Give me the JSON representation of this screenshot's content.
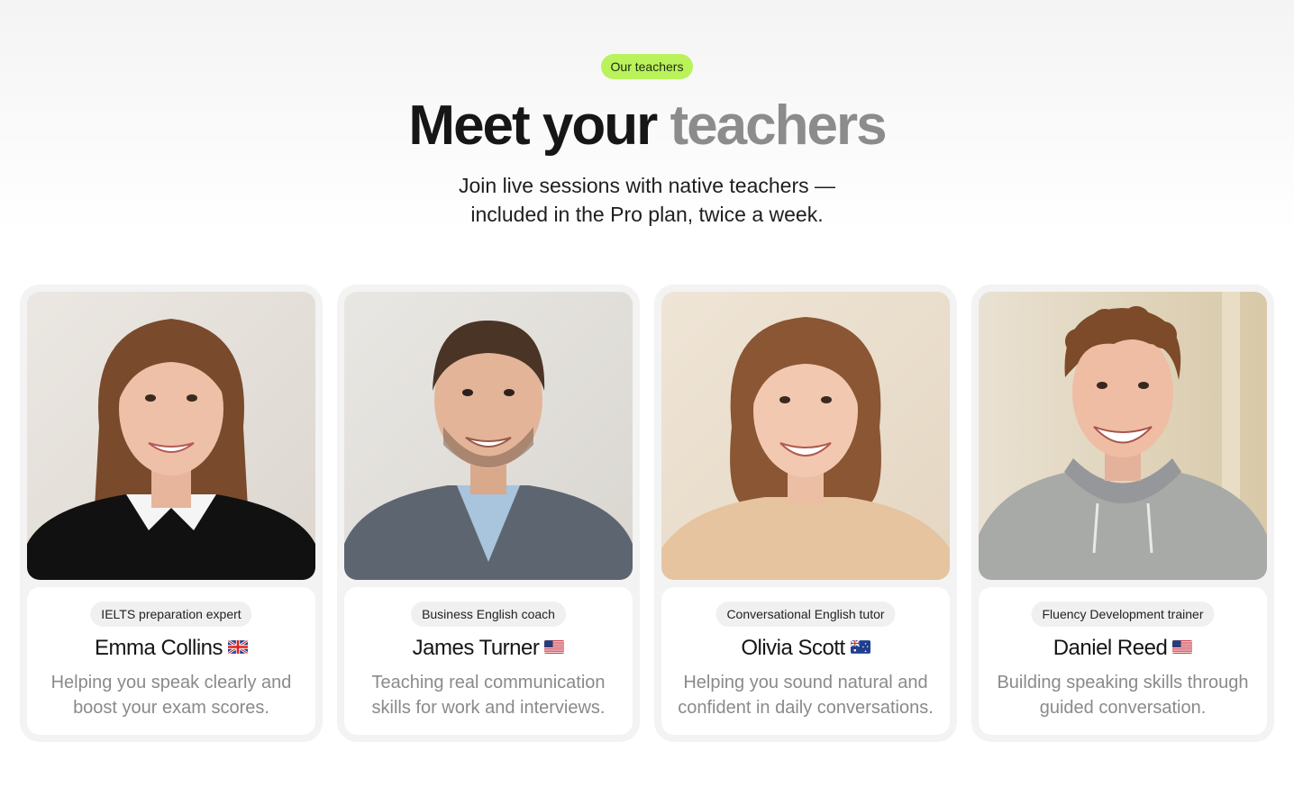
{
  "header": {
    "badge": "Our teachers",
    "title_main": "Meet your",
    "title_accent": "teachers",
    "subtitle_line1": "Join live sessions with native teachers —",
    "subtitle_line2": "included in the Pro plan, twice a week."
  },
  "colors": {
    "badge_bg": "#b9f25a",
    "title_accent": "#8c8c8c",
    "card_bg": "#f3f3f3"
  },
  "teachers": [
    {
      "role": "IELTS preparation expert",
      "name": "Emma Collins",
      "flag": "uk-flag-icon",
      "description": "Helping you speak clearly and boost your exam scores."
    },
    {
      "role": "Business English coach",
      "name": "James Turner",
      "flag": "us-flag-icon",
      "description": "Teaching real communication skills for work and interviews."
    },
    {
      "role": "Conversational English tutor",
      "name": "Olivia Scott",
      "flag": "australia-flag-icon",
      "description": "Helping you sound natural and confident in daily conversations."
    },
    {
      "role": "Fluency Development trainer",
      "name": "Daniel Reed",
      "flag": "us-flag-icon",
      "description": "Building speaking skills through guided conversation."
    }
  ]
}
